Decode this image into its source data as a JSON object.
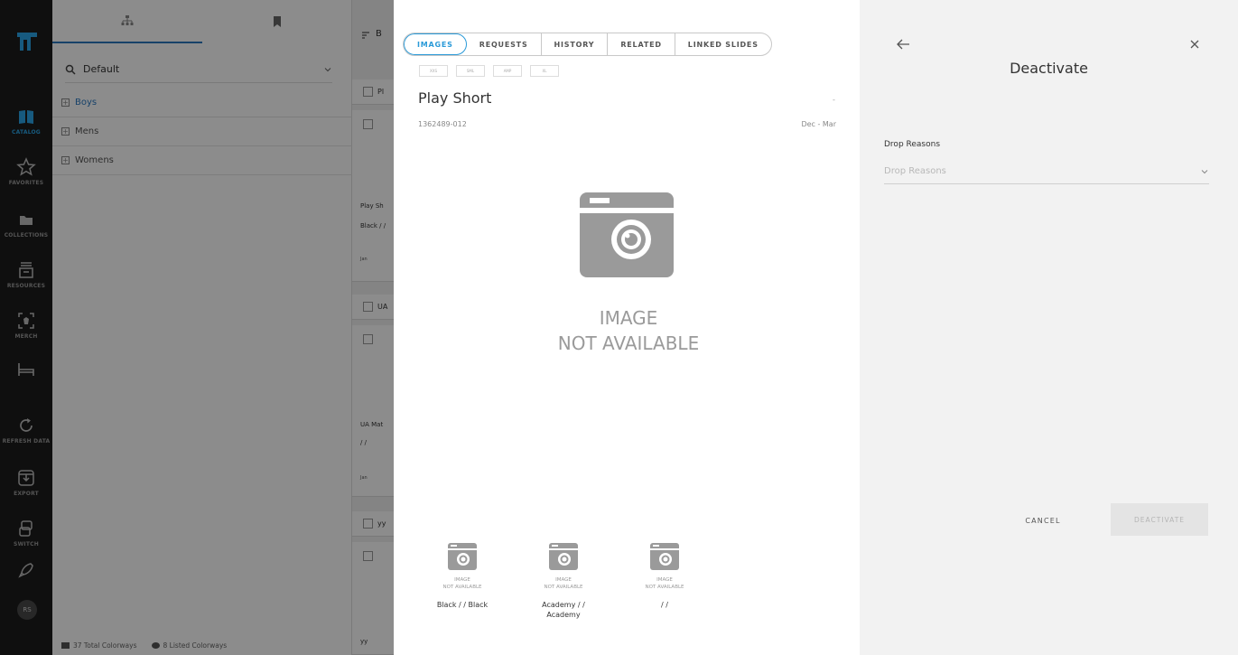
{
  "rail": {
    "items": [
      {
        "label": "CATALOG",
        "icon": "book-icon"
      },
      {
        "label": "FAVORITES",
        "icon": "star-icon"
      },
      {
        "label": "COLLECTIONS",
        "icon": "folder-icon"
      },
      {
        "label": "RESOURCES",
        "icon": "inbox-icon"
      },
      {
        "label": "MERCH",
        "icon": "merch-icon"
      },
      {
        "label": "",
        "icon": "bed-icon"
      },
      {
        "label": "REFRESH DATA",
        "icon": "refresh-icon"
      },
      {
        "label": "EXPORT",
        "icon": "export-icon"
      },
      {
        "label": "SWITCH",
        "icon": "switch-icon"
      },
      {
        "label": "",
        "icon": "rocket-icon"
      }
    ],
    "avatar": "RS",
    "accent": "#2aa5e8"
  },
  "tree": {
    "selector_label": "Default",
    "rows": [
      "Boys",
      "Mens",
      "Womens"
    ],
    "footer_total": "37 Total Colorways",
    "footer_listed": "8 Listed Colorways"
  },
  "grid": {
    "toolbar_letter": "B",
    "heads": [
      "Pl",
      "UA",
      "yy"
    ],
    "cards": [
      {
        "name": "Play Sh",
        "color": "Black / /",
        "season": "Jan"
      },
      {
        "name": "UA Mat",
        "color": "/ /",
        "season": "Jan"
      },
      {
        "name": "yy",
        "color": "",
        "season": ""
      }
    ]
  },
  "detail": {
    "tabs": [
      "IMAGES",
      "REQUESTS",
      "HISTORY",
      "RELATED",
      "LINKED SLIDES"
    ],
    "chips": [
      "XXS",
      "SML",
      "AMP",
      "XL"
    ],
    "title": "Play Short",
    "dash": "-",
    "sku": "1362489-012",
    "season": "Dec - Mar",
    "main_image_line1": "IMAGE",
    "main_image_line2": "NOT AVAILABLE",
    "thumbs": [
      {
        "na1": "IMAGE",
        "na2": "NOT AVAILABLE",
        "label": "Black / / Black"
      },
      {
        "na1": "IMAGE",
        "na2": "NOT AVAILABLE",
        "label": "Academy / / Academy"
      },
      {
        "na1": "IMAGE",
        "na2": "NOT AVAILABLE",
        "label": "/ /"
      }
    ]
  },
  "deactivate": {
    "title": "Deactivate",
    "field_label": "Drop Reasons",
    "field_placeholder": "Drop Reasons",
    "cancel_label": "CANCEL",
    "submit_label": "DEACTIVATE"
  }
}
